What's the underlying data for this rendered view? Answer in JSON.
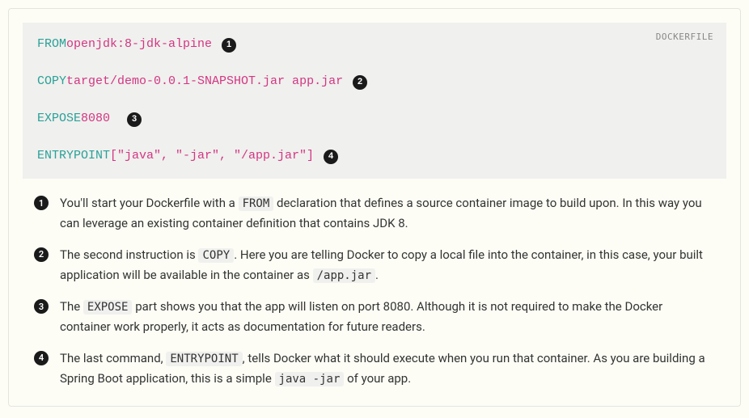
{
  "code_block": {
    "language_label": "DOCKERFILE",
    "lines": [
      {
        "keyword": "FROM",
        "args": "openjdk:8-jdk-alpine",
        "badge": "1"
      },
      {
        "blank": true
      },
      {
        "keyword": "COPY",
        "args": "target/demo-0.0.1-SNAPSHOT.jar app.jar",
        "badge": "2"
      },
      {
        "blank": true
      },
      {
        "keyword": "EXPOSE",
        "args": "8080 ",
        "badge": "3"
      },
      {
        "blank": true
      },
      {
        "keyword": "ENTRYPOINT",
        "args": "[\"java\", \"-jar\", \"/app.jar\"]",
        "badge": "4"
      }
    ]
  },
  "explanations": [
    {
      "badge": "1",
      "segments": [
        {
          "t": "text",
          "v": "You'll start your Dockerfile with a "
        },
        {
          "t": "code",
          "v": "FROM"
        },
        {
          "t": "text",
          "v": " declaration that defines a source container image to build upon. In this way you can leverage an existing container definition that contains JDK 8."
        }
      ]
    },
    {
      "badge": "2",
      "segments": [
        {
          "t": "text",
          "v": "The second instruction is "
        },
        {
          "t": "code",
          "v": "COPY"
        },
        {
          "t": "text",
          "v": ". Here you are telling Docker to copy a local file into the container, in this case, your built application will be available in the container as "
        },
        {
          "t": "code",
          "v": "/app.jar"
        },
        {
          "t": "text",
          "v": "."
        }
      ]
    },
    {
      "badge": "3",
      "segments": [
        {
          "t": "text",
          "v": "The "
        },
        {
          "t": "code",
          "v": "EXPOSE"
        },
        {
          "t": "text",
          "v": " part shows you that the app will listen on port 8080. Although it is not required to make the Docker container work properly, it acts as documentation for future readers."
        }
      ]
    },
    {
      "badge": "4",
      "segments": [
        {
          "t": "text",
          "v": "The last command, "
        },
        {
          "t": "code",
          "v": "ENTRYPOINT"
        },
        {
          "t": "text",
          "v": ", tells Docker what it should execute when you run that container. As you are building a Spring Boot application, this is a simple "
        },
        {
          "t": "code",
          "v": "java -jar"
        },
        {
          "t": "text",
          "v": " of your app."
        }
      ]
    }
  ]
}
